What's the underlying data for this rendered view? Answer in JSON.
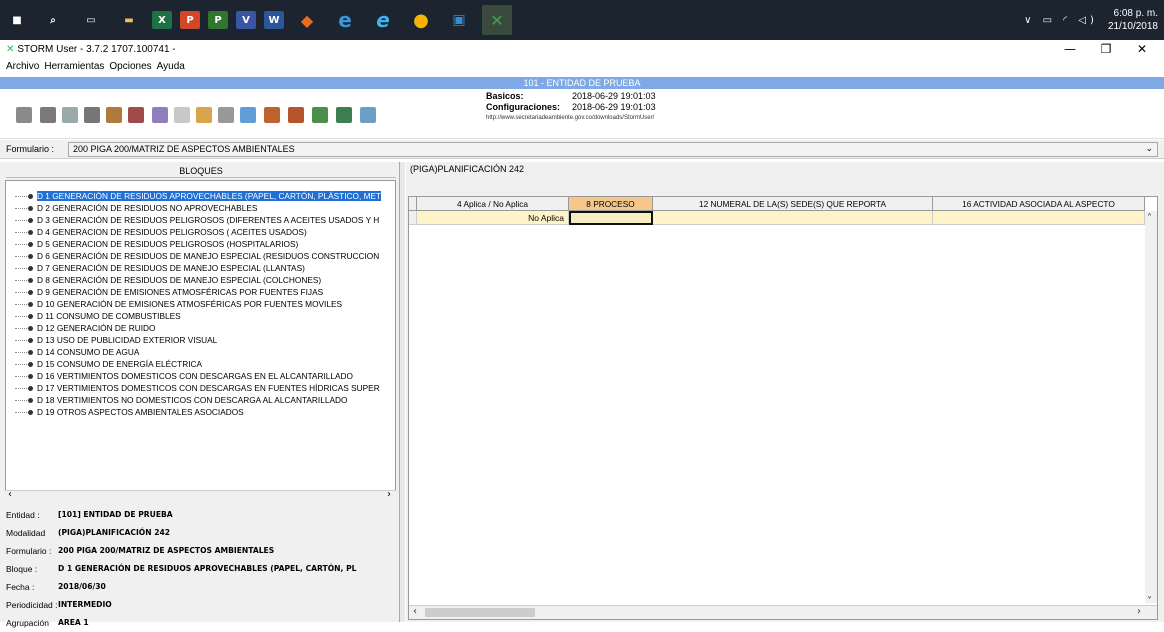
{
  "taskbar": {
    "icons": [
      {
        "name": "windows-start-icon",
        "glyph": "■"
      },
      {
        "name": "search-icon",
        "glyph": "⌕"
      },
      {
        "name": "task-view-icon",
        "glyph": "▭"
      },
      {
        "name": "file-explorer-icon",
        "glyph": "▬"
      },
      {
        "name": "excel-icon",
        "glyph": "X"
      },
      {
        "name": "powerpoint-icon",
        "glyph": "P"
      },
      {
        "name": "project-icon",
        "glyph": "P"
      },
      {
        "name": "visio-icon",
        "glyph": "V"
      },
      {
        "name": "word-icon",
        "glyph": "W"
      },
      {
        "name": "office-icon",
        "glyph": "◆"
      },
      {
        "name": "edge-icon",
        "glyph": "e"
      },
      {
        "name": "internet-explorer-icon",
        "glyph": "e"
      },
      {
        "name": "chrome-icon",
        "glyph": "●"
      },
      {
        "name": "app-icon",
        "glyph": "▣"
      },
      {
        "name": "storm-icon",
        "glyph": "✕"
      }
    ],
    "tray": "∨ ▭ ◜ ◁)",
    "time": "6:08 p. m.",
    "date": "21/10/2018"
  },
  "window": {
    "title": "STORM User - 3.7.2  1707.100741 -",
    "minimize": "—",
    "maximize": "❐",
    "close": "✕"
  },
  "menu": [
    "Archivo",
    "Herramientas",
    "Opciones",
    "Ayuda"
  ],
  "header": {
    "banner": "101 - ENTIDAD DE PRUEBA"
  },
  "info": {
    "basicos_label": "Basicos:",
    "basicos_value": "2018-06-29 19:01:03",
    "config_label": "Configuraciones:",
    "config_value": "2018-06-29 19:01:03",
    "url": "http://www.secretariadeambiente.gov.co/downloads/StormUser/"
  },
  "form": {
    "label": "Formulario :",
    "value": "200 PIGA 200/MATRIZ DE ASPECTOS AMBIENTALES"
  },
  "left": {
    "title": "BLOQUES",
    "items": [
      "D 1 GENERACIÓN DE RESIDUOS APROVECHABLES (PAPEL, CARTÓN, PLÁSTICO, MET",
      "D 2 GENERACIÓN DE RESIDUOS NO APROVECHABLES",
      "D 3 GENERACIÓN DE RESIDUOS PELIGROSOS (DIFERENTES A ACEITES USADOS Y H",
      "D 4 GENERACION DE RESIDUOS PELIGROSOS ( ACEITES USADOS)",
      "D 5 GENERACION DE RESIDUOS PELIGROSOS (HOSPITALARIOS)",
      "D 6 GENERACIÓN DE RESIDUOS DE MANEJO ESPECIAL (RESIDUOS CONSTRUCCION",
      "D 7  GENERACIÓN DE RESIDUOS DE MANEJO ESPECIAL (LLANTAS)",
      "D 8 GENERACIÓN DE RESIDUOS DE MANEJO ESPECIAL (COLCHONES)",
      "D 9 GENERACIÓN DE EMISIONES ATMOSFÉRICAS POR FUENTES FIJAS",
      "D 10 GENERACIÓN DE EMISIONES ATMOSFÉRICAS POR FUENTES MOVILES",
      "D 11 CONSUMO DE COMBUSTIBLES",
      "D 12  GENERACIÓN DE RUIDO",
      "D 13 USO DE PUBLICIDAD EXTERIOR VISUAL",
      "D 14 CONSUMO DE AGUA",
      "D 15 CONSUMO DE ENERGÍA ELÉCTRICA",
      "D 16 VERTIMIENTOS DOMESTICOS CON DESCARGAS EN EL ALCANTARILLADO",
      "D 17 VERTIMIENTOS DOMESTICOS CON DESCARGAS EN FUENTES HÍDRICAS SUPER",
      "D 18 VERTIMIENTOS NO DOMESTICOS CON DESCARGA AL ALCANTARILLADO",
      "D 19 OTROS ASPECTOS AMBIENTALES ASOCIADOS"
    ],
    "details": [
      {
        "label": "Entidad :",
        "value": "[101] ENTIDAD DE PRUEBA"
      },
      {
        "label": "Modalidad",
        "value": "(PIGA)PLANIFICACIÓN 242"
      },
      {
        "label": "Formulario :",
        "value": "200 PIGA 200/MATRIZ DE ASPECTOS AMBIENTALES"
      },
      {
        "label": "Bloque :",
        "value": "D 1 GENERACIÓN DE RESIDUOS APROVECHABLES (PAPEL, CARTÓN, PL"
      },
      {
        "label": "Fecha :",
        "value": "2018/06/30"
      },
      {
        "label": "Periodicidad :",
        "value": "INTERMEDIO"
      },
      {
        "label": "Agrupación",
        "value": "AREA 1"
      }
    ]
  },
  "right": {
    "title": "(PIGA)PLANIFICACIÓN 242",
    "columns": [
      "4 Aplica / No Aplica",
      "8 PROCESO",
      "12 NUMERAL DE LA(S) SEDE(S) QUE REPORTA",
      "16 ACTIVIDAD ASOCIADA AL ASPECTO"
    ],
    "row": [
      "No Aplica",
      "",
      "",
      ""
    ]
  },
  "colors": {
    "banner": "#7ea8e6",
    "highlight": "#f5c88a",
    "row": "#fff3c9",
    "selection": "#1f6fd6"
  }
}
